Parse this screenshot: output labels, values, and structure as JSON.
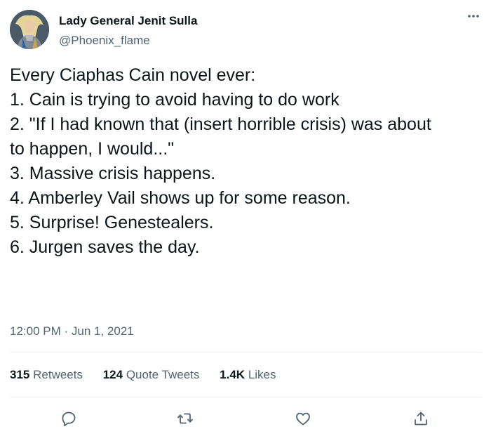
{
  "author": {
    "display_name": "Lady General Jenit Sulla",
    "handle": "@Phoenix_flame"
  },
  "tweet": {
    "lines": [
      "Every Ciaphas Cain novel ever:",
      "1. Cain is trying to avoid having to do work",
      "2. \"If I had known that (insert horrible crisis) was about",
      "to happen, I would...\"",
      "3. Massive crisis happens.",
      "4. Amberley Vail shows up for some reason.",
      "5. Surprise! Genestealers.",
      "6. Jurgen saves the day."
    ],
    "timestamp": "12:00 PM · Jun 1, 2021"
  },
  "stats": [
    {
      "count": "315",
      "label": "Retweets"
    },
    {
      "count": "124",
      "label": "Quote Tweets"
    },
    {
      "count": "1.4K",
      "label": "Likes"
    }
  ],
  "icons": {
    "more": "more-horizontal-icon",
    "reply": "reply-icon",
    "retweet": "retweet-icon",
    "like": "heart-icon",
    "share": "share-icon"
  },
  "colors": {
    "text": "#0f1419",
    "secondary": "#536471",
    "divider": "#eff3f4"
  }
}
